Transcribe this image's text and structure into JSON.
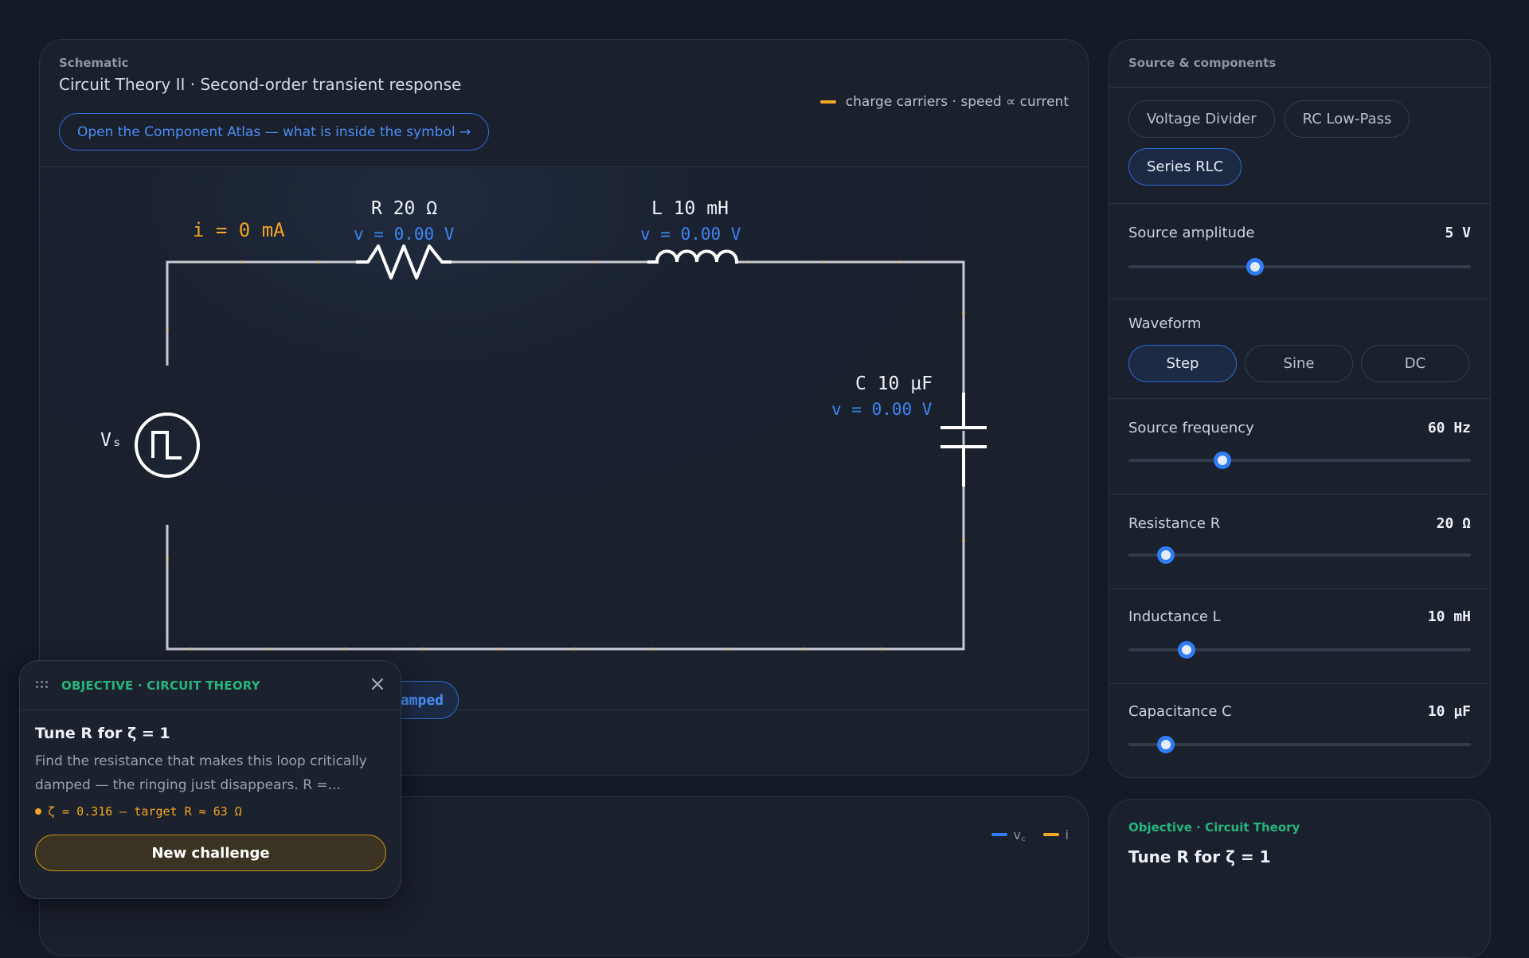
{
  "schematic": {
    "eyebrow": "Schematic",
    "title": "Circuit Theory II · Second-order transient response",
    "atlas_link": "Open the Component Atlas — what is inside the symbol →",
    "carrier_legend": "charge carriers · speed ∝ current",
    "current_readout": "i = 0 mA",
    "source_label": "Vₛ",
    "resistor": {
      "label": "R 20 Ω",
      "voltage": "v = 0.00 V"
    },
    "inductor": {
      "label": "L 10 mH",
      "voltage": "v = 0.00 V"
    },
    "capacitor": {
      "label": "C 10 µF",
      "voltage": "v = 0.00 V"
    },
    "regime_chip": "amped"
  },
  "plot": {
    "legend": [
      {
        "label": "v꜀",
        "color": "#2f7df5"
      },
      {
        "label": "i",
        "color": "#f5a623"
      }
    ]
  },
  "controls": {
    "presets_title": "Source & components",
    "presets": [
      {
        "label": "Voltage Divider",
        "active": false
      },
      {
        "label": "RC Low-Pass",
        "active": false
      },
      {
        "label": "Series RLC",
        "active": true
      }
    ],
    "amplitude": {
      "label": "Source amplitude",
      "value": "5 V",
      "fraction": 0.37
    },
    "waveform": {
      "label": "Waveform",
      "options": [
        {
          "label": "Step",
          "active": true
        },
        {
          "label": "Sine",
          "active": false
        },
        {
          "label": "DC",
          "active": false
        }
      ]
    },
    "frequency": {
      "label": "Source frequency",
      "value": "60 Hz",
      "fraction": 0.275
    },
    "resistance": {
      "label": "Resistance R",
      "value": "20 Ω",
      "fraction": 0.11
    },
    "inductance": {
      "label": "Inductance L",
      "value": "10 mH",
      "fraction": 0.17
    },
    "capacitance": {
      "label": "Capacitance C",
      "value": "10 µF",
      "fraction": 0.11
    }
  },
  "objective_right": {
    "eyebrow": "Objective · Circuit Theory",
    "title": "Tune R for ζ = 1"
  },
  "objective_popup": {
    "eyebrow": "OBJECTIVE · CIRCUIT THEORY",
    "title": "Tune R for ζ = 1",
    "description": "Find the resistance that makes this loop critically damped — the ringing just disappears. R =...",
    "status": "ζ = 0.316 — target R ≈ 63 Ω",
    "button": "New challenge"
  },
  "colors": {
    "accent_blue": "#2f7df5",
    "accent_orange": "#f5a623",
    "accent_green": "#26b57b",
    "wire": "#c9ccd2"
  }
}
